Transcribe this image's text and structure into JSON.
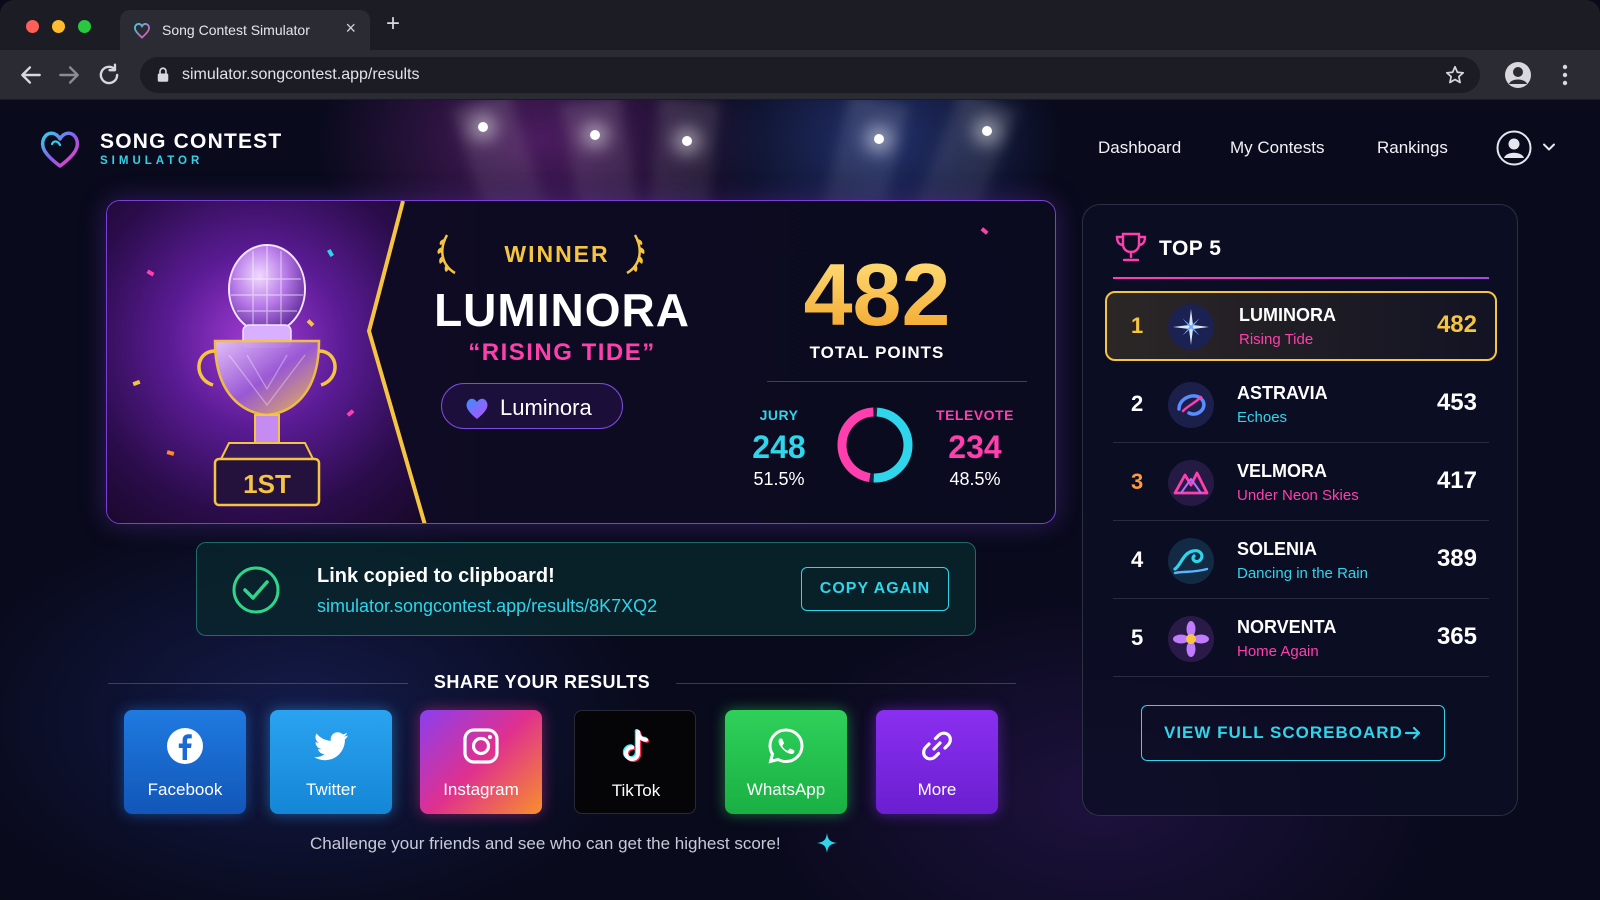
{
  "browser": {
    "tab_title": "Song Contest Simulator",
    "url": "simulator.songcontest.app/results",
    "icons": [
      "back-icon",
      "forward-icon",
      "reload-icon",
      "lock-icon",
      "star-icon",
      "profile-icon",
      "menu-icon"
    ]
  },
  "brand": {
    "name": "SONG CONTEST",
    "subtitle": "SIMULATOR"
  },
  "nav": {
    "dashboard": "Dashboard",
    "my_contests": "My Contests",
    "rankings": "Rankings"
  },
  "winner": {
    "label": "WINNER",
    "artist": "LUMINORA",
    "song": "“RISING TIDE”",
    "pill": "Luminora",
    "place_badge": "1ST",
    "total_points": "482",
    "total_label": "TOTAL POINTS",
    "jury": {
      "label": "JURY",
      "points": "248",
      "percent": "51.5%"
    },
    "televote": {
      "label": "TELEVOTE",
      "points": "234",
      "percent": "48.5%"
    },
    "jury_share": 0.515
  },
  "clipboard": {
    "message": "Link copied to clipboard!",
    "link": "simulator.songcontest.app/results/8K7XQ2",
    "button": "COPY AGAIN"
  },
  "share": {
    "heading": "SHARE YOUR RESULTS",
    "buttons": {
      "facebook": "Facebook",
      "twitter": "Twitter",
      "instagram": "Instagram",
      "tiktok": "TikTok",
      "whatsapp": "WhatsApp",
      "more": "More"
    },
    "challenge": "Challenge your friends and see who can get the highest score!"
  },
  "top5": {
    "title": "TOP 5",
    "entries": [
      {
        "rank": "1",
        "artist": "LUMINORA",
        "song": "Rising Tide",
        "score": "482"
      },
      {
        "rank": "2",
        "artist": "ASTRAVIA",
        "song": "Echoes",
        "score": "453"
      },
      {
        "rank": "3",
        "artist": "VELMORA",
        "song": "Under Neon Skies",
        "score": "417"
      },
      {
        "rank": "4",
        "artist": "SOLENIA",
        "song": "Dancing in the Rain",
        "score": "389"
      },
      {
        "rank": "5",
        "artist": "NORVENTA",
        "song": "Home Again",
        "score": "365"
      }
    ],
    "view_full": "VIEW FULL SCOREBOARD"
  },
  "colors": {
    "gold": "#f5c542",
    "cyan": "#2fd5ea",
    "pink": "#ff3fae",
    "purple": "#7b3fd6"
  }
}
